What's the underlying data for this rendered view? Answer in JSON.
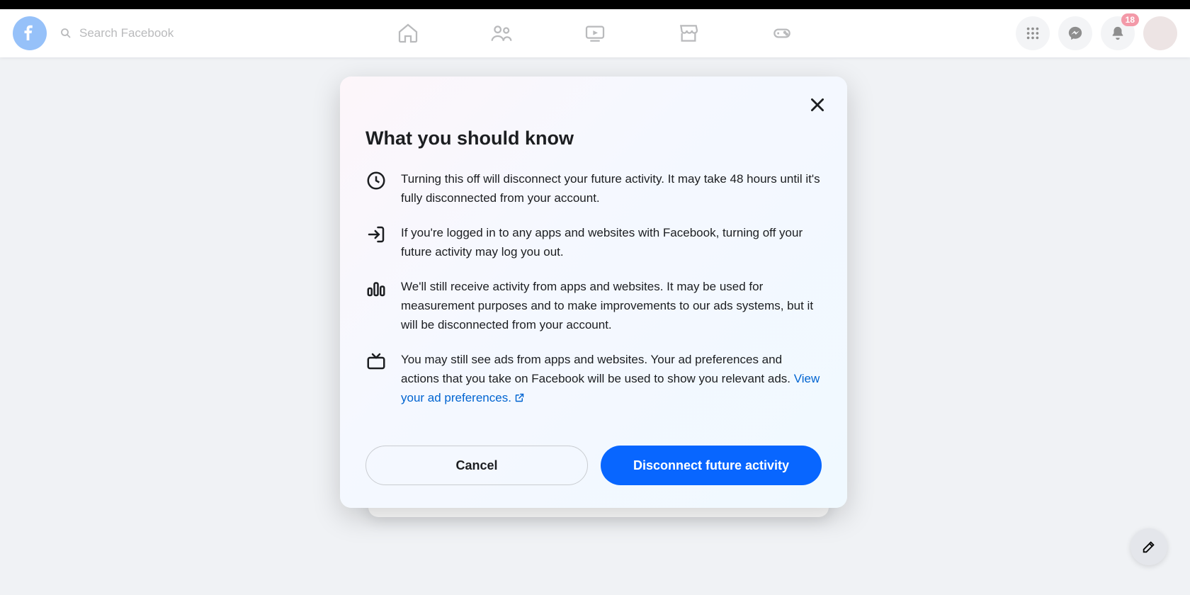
{
  "header": {
    "search_placeholder": "Search Facebook",
    "notification_count": "18"
  },
  "modal": {
    "title": "What you should know",
    "items": [
      {
        "text": "Turning this off will disconnect your future activity. It may take 48 hours until it's fully disconnected from your account."
      },
      {
        "text": "If you're logged in to any apps and websites with Facebook, turning off your future activity may log you out."
      },
      {
        "text": "We'll still receive activity from apps and websites. It may be used for measurement purposes and to make improvements to our ads systems, but it will be disconnected from your account."
      },
      {
        "text": "You may still see ads from apps and websites. Your ad preferences and actions that you take on Facebook will be used to show you relevant ads. "
      }
    ],
    "link_text": "View your ad preferences.",
    "cancel_label": "Cancel",
    "confirm_label": "Disconnect future activity"
  }
}
